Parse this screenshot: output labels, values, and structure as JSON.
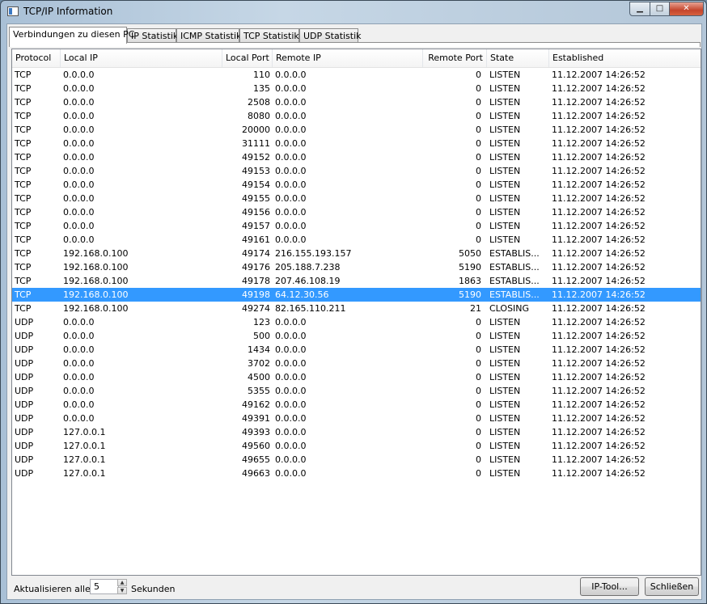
{
  "window": {
    "title": "TCP/IP Information",
    "minimize_glyph": "▁",
    "maximize_glyph": "□",
    "close_glyph": "✕"
  },
  "tabs": [
    {
      "label": "Verbindungen zu diesen PC"
    },
    {
      "label": "IP Statistik"
    },
    {
      "label": "ICMP Statistik"
    },
    {
      "label": "TCP Statistik"
    },
    {
      "label": "UDP Statistik"
    }
  ],
  "table": {
    "columns": [
      "Protocol",
      "Local IP",
      "Local Port",
      "Remote IP",
      "Remote Port",
      "State",
      "Established"
    ],
    "selected_row": 16,
    "selection_color": "#3399ff",
    "rows": [
      [
        "TCP",
        "0.0.0.0",
        "110",
        "0.0.0.0",
        "0",
        "LISTEN",
        "11.12.2007 14:26:52"
      ],
      [
        "TCP",
        "0.0.0.0",
        "135",
        "0.0.0.0",
        "0",
        "LISTEN",
        "11.12.2007 14:26:52"
      ],
      [
        "TCP",
        "0.0.0.0",
        "2508",
        "0.0.0.0",
        "0",
        "LISTEN",
        "11.12.2007 14:26:52"
      ],
      [
        "TCP",
        "0.0.0.0",
        "8080",
        "0.0.0.0",
        "0",
        "LISTEN",
        "11.12.2007 14:26:52"
      ],
      [
        "TCP",
        "0.0.0.0",
        "20000",
        "0.0.0.0",
        "0",
        "LISTEN",
        "11.12.2007 14:26:52"
      ],
      [
        "TCP",
        "0.0.0.0",
        "31111",
        "0.0.0.0",
        "0",
        "LISTEN",
        "11.12.2007 14:26:52"
      ],
      [
        "TCP",
        "0.0.0.0",
        "49152",
        "0.0.0.0",
        "0",
        "LISTEN",
        "11.12.2007 14:26:52"
      ],
      [
        "TCP",
        "0.0.0.0",
        "49153",
        "0.0.0.0",
        "0",
        "LISTEN",
        "11.12.2007 14:26:52"
      ],
      [
        "TCP",
        "0.0.0.0",
        "49154",
        "0.0.0.0",
        "0",
        "LISTEN",
        "11.12.2007 14:26:52"
      ],
      [
        "TCP",
        "0.0.0.0",
        "49155",
        "0.0.0.0",
        "0",
        "LISTEN",
        "11.12.2007 14:26:52"
      ],
      [
        "TCP",
        "0.0.0.0",
        "49156",
        "0.0.0.0",
        "0",
        "LISTEN",
        "11.12.2007 14:26:52"
      ],
      [
        "TCP",
        "0.0.0.0",
        "49157",
        "0.0.0.0",
        "0",
        "LISTEN",
        "11.12.2007 14:26:52"
      ],
      [
        "TCP",
        "0.0.0.0",
        "49161",
        "0.0.0.0",
        "0",
        "LISTEN",
        "11.12.2007 14:26:52"
      ],
      [
        "TCP",
        "192.168.0.100",
        "49174",
        "216.155.193.157",
        "5050",
        "ESTABLIS...",
        "11.12.2007 14:26:52"
      ],
      [
        "TCP",
        "192.168.0.100",
        "49176",
        "205.188.7.238",
        "5190",
        "ESTABLIS...",
        "11.12.2007 14:26:52"
      ],
      [
        "TCP",
        "192.168.0.100",
        "49178",
        "207.46.108.19",
        "1863",
        "ESTABLIS...",
        "11.12.2007 14:26:52"
      ],
      [
        "TCP",
        "192.168.0.100",
        "49198",
        "64.12.30.56",
        "5190",
        "ESTABLIS...",
        "11.12.2007 14:26:52"
      ],
      [
        "TCP",
        "192.168.0.100",
        "49274",
        "82.165.110.211",
        "21",
        "CLOSING",
        "11.12.2007 14:26:52"
      ],
      [
        "UDP",
        "0.0.0.0",
        "123",
        "0.0.0.0",
        "0",
        "LISTEN",
        "11.12.2007 14:26:52"
      ],
      [
        "UDP",
        "0.0.0.0",
        "500",
        "0.0.0.0",
        "0",
        "LISTEN",
        "11.12.2007 14:26:52"
      ],
      [
        "UDP",
        "0.0.0.0",
        "1434",
        "0.0.0.0",
        "0",
        "LISTEN",
        "11.12.2007 14:26:52"
      ],
      [
        "UDP",
        "0.0.0.0",
        "3702",
        "0.0.0.0",
        "0",
        "LISTEN",
        "11.12.2007 14:26:52"
      ],
      [
        "UDP",
        "0.0.0.0",
        "4500",
        "0.0.0.0",
        "0",
        "LISTEN",
        "11.12.2007 14:26:52"
      ],
      [
        "UDP",
        "0.0.0.0",
        "5355",
        "0.0.0.0",
        "0",
        "LISTEN",
        "11.12.2007 14:26:52"
      ],
      [
        "UDP",
        "0.0.0.0",
        "49162",
        "0.0.0.0",
        "0",
        "LISTEN",
        "11.12.2007 14:26:52"
      ],
      [
        "UDP",
        "0.0.0.0",
        "49391",
        "0.0.0.0",
        "0",
        "LISTEN",
        "11.12.2007 14:26:52"
      ],
      [
        "UDP",
        "127.0.0.1",
        "49393",
        "0.0.0.0",
        "0",
        "LISTEN",
        "11.12.2007 14:26:52"
      ],
      [
        "UDP",
        "127.0.0.1",
        "49560",
        "0.0.0.0",
        "0",
        "LISTEN",
        "11.12.2007 14:26:52"
      ],
      [
        "UDP",
        "127.0.0.1",
        "49655",
        "0.0.0.0",
        "0",
        "LISTEN",
        "11.12.2007 14:26:52"
      ],
      [
        "UDP",
        "127.0.0.1",
        "49663",
        "0.0.0.0",
        "0",
        "LISTEN",
        "11.12.2007 14:26:52"
      ]
    ]
  },
  "footer": {
    "refresh_label": "Aktualisieren alle:",
    "refresh_value": "5",
    "unit_label": "Sekunden",
    "iptool_button": "IP-Tool...",
    "close_button": "Schließen"
  },
  "icons": {
    "spin_up": "spin-up-icon",
    "spin_down": "spin-down-icon",
    "app": "app-window-icon"
  }
}
